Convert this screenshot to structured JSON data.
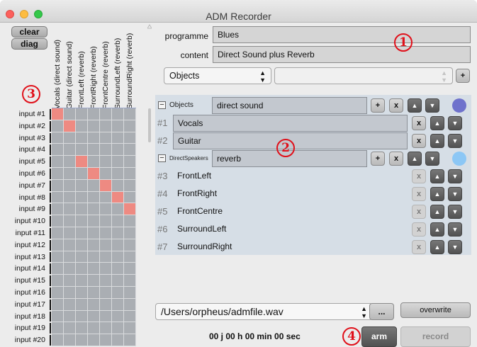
{
  "window": {
    "title": "ADM Recorder"
  },
  "matrix": {
    "clear_label": "clear",
    "diag_label": "diag",
    "columns": [
      "Vocals (direct sound)",
      "Guitar (direct sound)",
      "FrontLeft (reverb)",
      "FrontRight (reverb)",
      "FrontCentre (reverb)",
      "SurroundLeft (reverb)",
      "SurroundRight (reverb)"
    ],
    "rows": [
      "input #1",
      "input #2",
      "input #3",
      "input #4",
      "input #5",
      "input #6",
      "input #7",
      "input #8",
      "input #9",
      "input #10",
      "input #11",
      "input #12",
      "input #13",
      "input #14",
      "input #15",
      "input #16",
      "input #17",
      "input #18",
      "input #19",
      "input #20"
    ],
    "active": [
      [
        0,
        0
      ],
      [
        1,
        1
      ],
      [
        4,
        2
      ],
      [
        5,
        3
      ],
      [
        6,
        4
      ],
      [
        7,
        5
      ],
      [
        8,
        6
      ]
    ]
  },
  "meta": {
    "programme_label": "programme",
    "programme_value": "Blues",
    "content_label": "content",
    "content_value": "Direct Sound plus Reverb"
  },
  "type_select": {
    "value": "Objects",
    "add_label": "+"
  },
  "groups": [
    {
      "type": "Objects",
      "name": "direct sound",
      "color": "#6f72cc",
      "items": [
        {
          "idx": "#1",
          "name": "Vocals"
        },
        {
          "idx": "#2",
          "name": "Guitar"
        }
      ]
    },
    {
      "type": "DirectSpeakers",
      "name": "reverb",
      "color": "#8cc7f5",
      "items": [
        {
          "idx": "#3",
          "name": "FrontLeft"
        },
        {
          "idx": "#4",
          "name": "FrontRight"
        },
        {
          "idx": "#5",
          "name": "FrontCentre"
        },
        {
          "idx": "#6",
          "name": "SurroundLeft"
        },
        {
          "idx": "#7",
          "name": "SurroundRight"
        }
      ]
    }
  ],
  "buttons": {
    "plus": "+",
    "x": "x",
    "up": "▲",
    "down": "▼"
  },
  "file": {
    "path": "/Users/orpheus/admfile.wav",
    "browse": "...",
    "overwrite": "overwrite"
  },
  "transport": {
    "time": "00 j 00 h 00 min 00 sec",
    "arm": "arm",
    "record": "record"
  },
  "annotations": [
    "1",
    "2",
    "3",
    "4"
  ]
}
